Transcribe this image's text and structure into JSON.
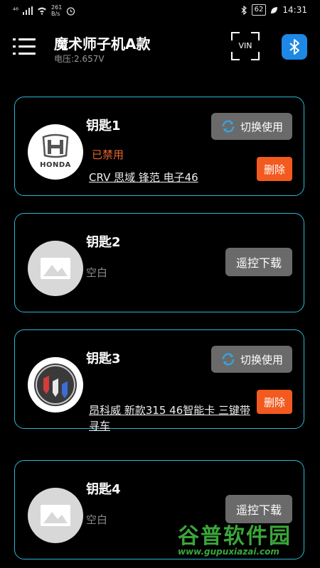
{
  "status_bar": {
    "network": "⁴⁶",
    "speed": "261\nB/s",
    "battery": "62",
    "time": "14:31"
  },
  "header": {
    "title": "魔术师子机A款",
    "subtitle": "电压:2.657V",
    "vin_label": "VIN"
  },
  "keys": [
    {
      "name": "钥匙1",
      "logo": "honda-logo",
      "logo_text": "HONDA",
      "status": "已禁用",
      "description": "CRV 思域 锋范 电子46",
      "switch_label": "切换使用",
      "delete_label": "删除"
    },
    {
      "name": "钥匙2",
      "logo": "placeholder-image-icon",
      "empty_label": "空白",
      "download_label": "遥控下载"
    },
    {
      "name": "钥匙3",
      "logo": "buick-logo",
      "description": "昂科威 新款315 46智能卡 三键带寻车",
      "switch_label": "切换使用",
      "delete_label": "删除"
    },
    {
      "name": "钥匙4",
      "logo": "placeholder-image-icon",
      "empty_label": "空白",
      "download_label": "遥控下载"
    }
  ],
  "watermark": {
    "title": "谷普软件园",
    "url": "www.gupuxiazai.com"
  },
  "colors": {
    "accent_border": "#2bb7d4",
    "delete": "#f25a1f",
    "bluetooth": "#1E88E5",
    "disabled_text": "#e8652f"
  }
}
